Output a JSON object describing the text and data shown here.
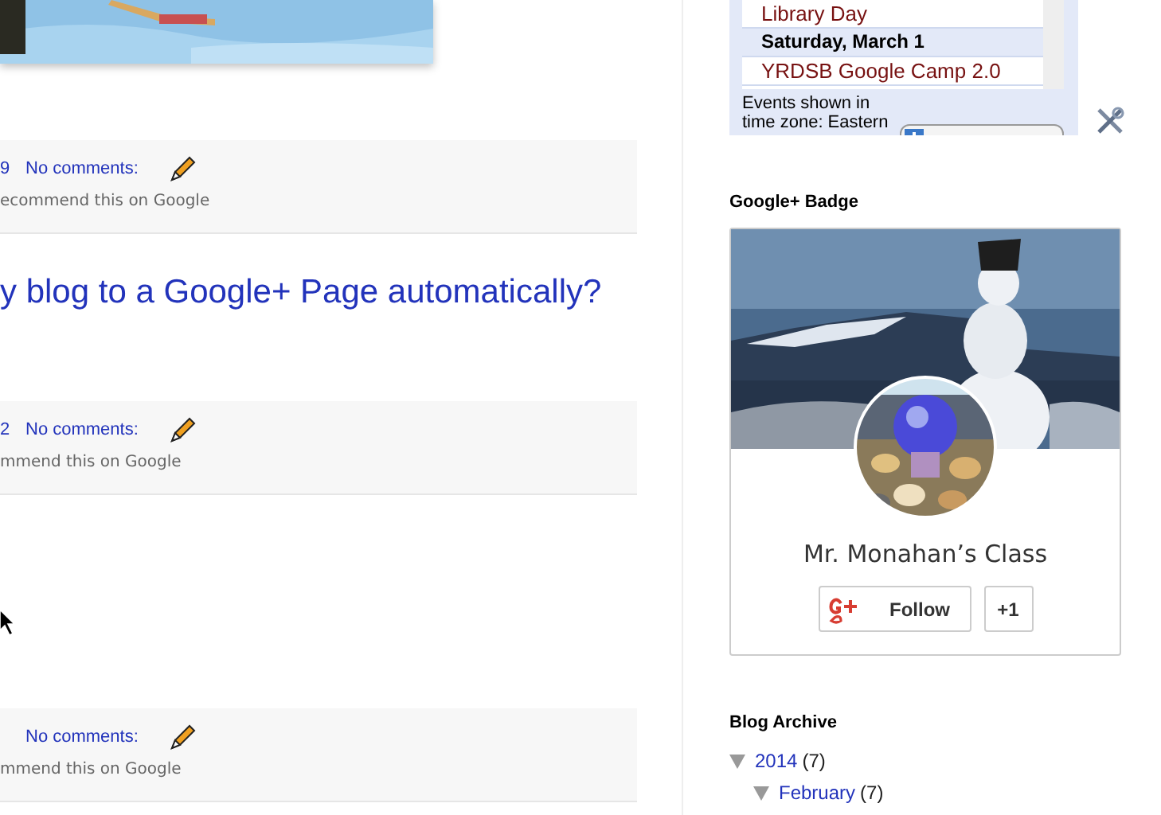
{
  "posts": [
    {
      "date_fragment": "9",
      "comments": "No comments:",
      "recommend": "ecommend this on Google"
    },
    {
      "title": "y blog to a Google+ Page automatically?",
      "date_fragment": "2",
      "comments": "No comments:",
      "recommend": "mmend this on Google"
    },
    {
      "comments": "No comments:",
      "recommend": "mmend this on Google"
    }
  ],
  "calendar": {
    "rows": [
      {
        "kind": "event",
        "text": "Library Day"
      },
      {
        "kind": "day",
        "text": "Saturday, March 1"
      },
      {
        "kind": "event",
        "text": "YRDSB Google Camp 2.0"
      }
    ],
    "timezone_note": "Events shown in time zone: Eastern"
  },
  "badge": {
    "heading": "Google+ Badge",
    "name": "Mr. Monahan’s Class",
    "follow": "Follow",
    "plus_one": "+1"
  },
  "archive": {
    "heading": "Blog Archive",
    "items": [
      {
        "label": "2014",
        "count": "(7)",
        "expanded": true,
        "children": [
          {
            "label": "February",
            "count": "(7)",
            "expanded": true
          }
        ]
      }
    ]
  }
}
